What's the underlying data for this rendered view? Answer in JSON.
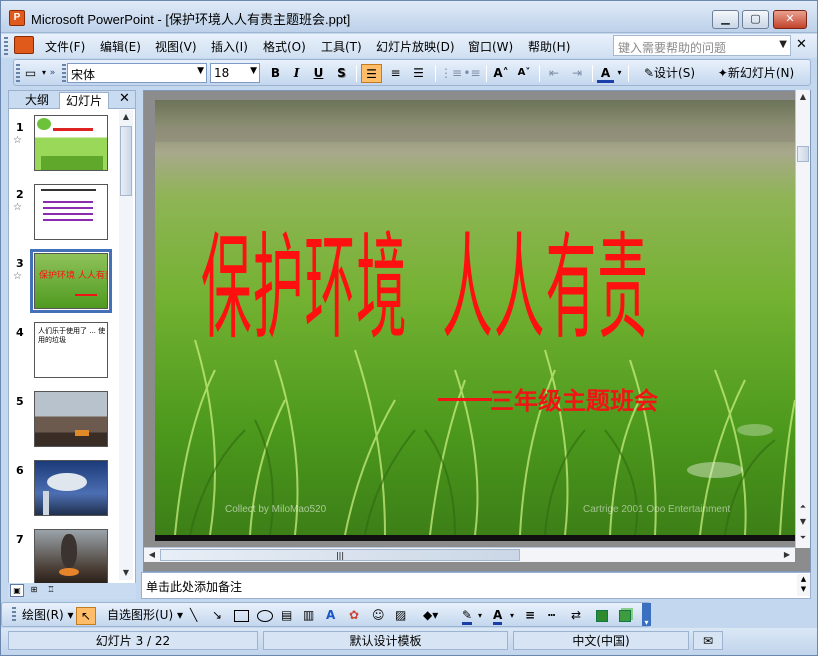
{
  "window": {
    "title": "Microsoft PowerPoint - [保护环境人人有责主题班会.ppt]",
    "app_icon": "powerpoint-icon",
    "minimize": "▁",
    "maximize": "▢",
    "close": "✕"
  },
  "menu": {
    "items": [
      "文件(F)",
      "编辑(E)",
      "视图(V)",
      "插入(I)",
      "格式(O)",
      "工具(T)",
      "幻灯片放映(D)",
      "窗口(W)",
      "帮助(H)"
    ],
    "help_placeholder": "键入需要帮助的问题",
    "close": "✕"
  },
  "format_toolbar": {
    "font": "宋体",
    "size": "18",
    "bold": "B",
    "italic": "I",
    "underline": "U",
    "shadow": "S",
    "design": "设计(S)",
    "new_slide": "新幻灯片(N)"
  },
  "left_pane": {
    "tabs": [
      "大纲",
      "幻灯片"
    ],
    "active_tab": "幻灯片",
    "close": "✕",
    "thumbnails": [
      {
        "num": "1",
        "star": "☆"
      },
      {
        "num": "2",
        "star": "☆"
      },
      {
        "num": "3",
        "star": "☆"
      },
      {
        "num": "4",
        "star": ""
      },
      {
        "num": "5",
        "star": ""
      },
      {
        "num": "6",
        "star": ""
      },
      {
        "num": "7",
        "star": ""
      }
    ],
    "thumb4_text": "人们乐于使用了 ... 使用的垃圾"
  },
  "slide": {
    "title_left": "保护环境",
    "title_right": "人人有责",
    "subtitle": "三年级主题班会",
    "credit_left": "Collect by MiloMao520",
    "credit_right": "Cartrige 2001 Ooo Entertainment"
  },
  "notes": {
    "placeholder": "单击此处添加备注"
  },
  "drawing_toolbar": {
    "draw": "绘图(R)",
    "autoshape": "自选图形(U)"
  },
  "status": {
    "slide_info": "幻灯片 3 / 22",
    "template": "默认设计模板",
    "language": "中文(中国)"
  },
  "colors": {
    "accent": "#ffbd6a",
    "title_red": "#ff1010",
    "chrome": "#c3d7ef"
  }
}
